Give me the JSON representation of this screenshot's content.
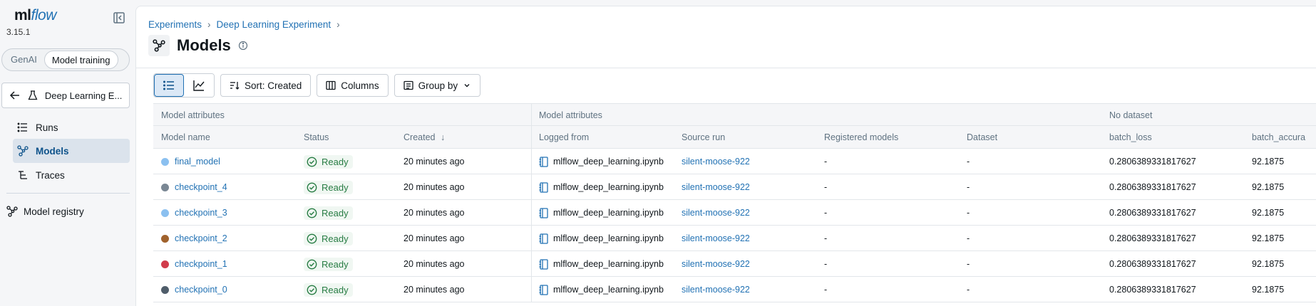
{
  "app": {
    "logo_ml": "ml",
    "logo_flow": "flow",
    "version": "3.15.1"
  },
  "sidebar": {
    "mode_genai": "GenAI",
    "mode_training": "Model training",
    "experiment_button": "Deep Learning E...",
    "nav": [
      {
        "label": "Runs",
        "icon": "runs-icon"
      },
      {
        "label": "Models",
        "icon": "models-icon",
        "active": true
      },
      {
        "label": "Traces",
        "icon": "traces-icon"
      }
    ],
    "registry": "Model registry"
  },
  "breadcrumb": {
    "items": [
      "Experiments",
      "Deep Learning Experiment"
    ],
    "separator": "›"
  },
  "page": {
    "title": "Models"
  },
  "toolbar": {
    "sort": "Sort: Created",
    "columns": "Columns",
    "group_by": "Group by"
  },
  "table": {
    "groups": [
      "Model attributes",
      "Model attributes",
      "No dataset"
    ],
    "headers": [
      "Model name",
      "Status",
      "Created",
      "Logged from",
      "Source run",
      "Registered models",
      "Dataset",
      "batch_loss",
      "batch_accura"
    ],
    "sort_arrow": "↓",
    "rows": [
      {
        "name": "final_model",
        "dot": "#8bc0f0",
        "status": "Ready",
        "created": "20 minutes ago",
        "logged_from": "mlflow_deep_learning.ipynb",
        "source_run": "silent-moose-922",
        "registered": "-",
        "dataset": "-",
        "batch_loss": "0.2806389331817627",
        "batch_acc": "92.1875"
      },
      {
        "name": "checkpoint_4",
        "dot": "#7a8794",
        "status": "Ready",
        "created": "20 minutes ago",
        "logged_from": "mlflow_deep_learning.ipynb",
        "source_run": "silent-moose-922",
        "registered": "-",
        "dataset": "-",
        "batch_loss": "0.2806389331817627",
        "batch_acc": "92.1875"
      },
      {
        "name": "checkpoint_3",
        "dot": "#8bc0f0",
        "status": "Ready",
        "created": "20 minutes ago",
        "logged_from": "mlflow_deep_learning.ipynb",
        "source_run": "silent-moose-922",
        "registered": "-",
        "dataset": "-",
        "batch_loss": "0.2806389331817627",
        "batch_acc": "92.1875"
      },
      {
        "name": "checkpoint_2",
        "dot": "#a0622d",
        "status": "Ready",
        "created": "20 minutes ago",
        "logged_from": "mlflow_deep_learning.ipynb",
        "source_run": "silent-moose-922",
        "registered": "-",
        "dataset": "-",
        "batch_loss": "0.2806389331817627",
        "batch_acc": "92.1875"
      },
      {
        "name": "checkpoint_1",
        "dot": "#d13c4b",
        "status": "Ready",
        "created": "20 minutes ago",
        "logged_from": "mlflow_deep_learning.ipynb",
        "source_run": "silent-moose-922",
        "registered": "-",
        "dataset": "-",
        "batch_loss": "0.2806389331817627",
        "batch_acc": "92.1875"
      },
      {
        "name": "checkpoint_0",
        "dot": "#4f5d6a",
        "status": "Ready",
        "created": "20 minutes ago",
        "logged_from": "mlflow_deep_learning.ipynb",
        "source_run": "silent-moose-922",
        "registered": "-",
        "dataset": "-",
        "batch_loss": "0.2806389331817627",
        "batch_acc": "92.1875"
      }
    ]
  },
  "colors": {
    "accent": "#2272b4",
    "status_ready": "#277c43"
  }
}
